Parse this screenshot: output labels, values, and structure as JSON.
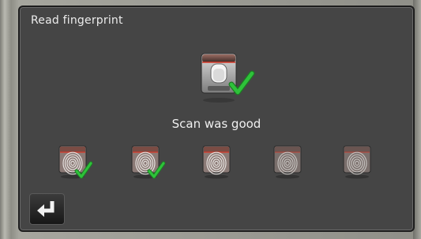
{
  "window": {
    "title": "Read fingerprint"
  },
  "scan": {
    "status_text": "Scan was good",
    "large_icon": "fingerprint-scanner-check-icon",
    "samples": [
      {
        "icon": "fingerprint-icon",
        "accepted": true
      },
      {
        "icon": "fingerprint-icon",
        "accepted": true
      },
      {
        "icon": "fingerprint-icon",
        "accepted": false
      },
      {
        "icon": "fingerprint-icon",
        "accepted": false
      },
      {
        "icon": "fingerprint-icon",
        "accepted": false
      }
    ]
  },
  "navigation": {
    "back_icon": "return-arrow-icon"
  },
  "colors": {
    "screen_bg": "#454545",
    "check_green": "#2ec23a",
    "scan_line_red": "#d93a2a",
    "text": "#ececec"
  }
}
